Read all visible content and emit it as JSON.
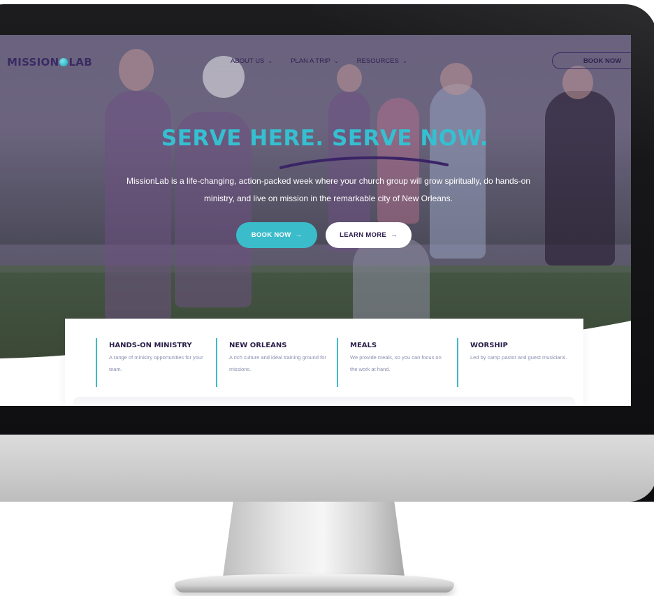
{
  "brand": {
    "logo_left": "MISSION",
    "logo_right": "LAB",
    "accent_color": "#3bbccb",
    "primary_color": "#2e2250"
  },
  "nav": {
    "items": [
      {
        "label": "ABOUT US",
        "icon": "chevron-down-icon"
      },
      {
        "label": "PLAN A TRIP",
        "icon": "chevron-down-icon"
      },
      {
        "label": "RESOURCES",
        "icon": "chevron-down-icon"
      }
    ],
    "book_label": "BOOK NOW"
  },
  "hero": {
    "title": "SERVE HERE. SERVE NOW.",
    "text": "MissionLab is a life-changing, action-packed week where your church group will grow spiritually, do hands-on ministry, and live on mission in the remarkable city of New Orleans.",
    "book_button": "BOOK NOW",
    "learn_button": "LEARN MORE",
    "arrow": "→"
  },
  "features": [
    {
      "title": "HANDS-ON MINISTRY",
      "desc": "A range of ministry opportunities for your team."
    },
    {
      "title": "NEW ORLEANS",
      "desc": "A rich culture and ideal training ground for missions."
    },
    {
      "title": "MEALS",
      "desc": "We provide meals, so you can focus on the work at hand."
    },
    {
      "title": "WORSHIP",
      "desc": "Led by camp pastor and guest musicians."
    }
  ]
}
